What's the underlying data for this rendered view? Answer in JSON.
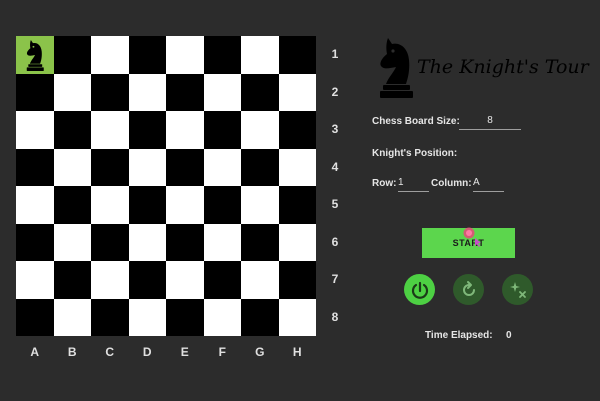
{
  "title": "The Knight's Tour",
  "board": {
    "size": 8,
    "knight_square": "A1",
    "rows": [
      "1",
      "2",
      "3",
      "4",
      "5",
      "6",
      "7",
      "8"
    ],
    "columns": [
      "A",
      "B",
      "C",
      "D",
      "E",
      "F",
      "G",
      "H"
    ],
    "colors": {
      "light": "#ffffff",
      "dark": "#000000",
      "knight_highlight": "#8bc34a"
    }
  },
  "form": {
    "board_size_label": "Chess Board Size:",
    "board_size_value": "8",
    "position_label": "Knight's Position:",
    "row_label": "Row:",
    "row_value": "1",
    "column_label": "Column:",
    "column_value": "A"
  },
  "controls": {
    "start_label": "START",
    "start_color": "#5cd64d",
    "icons": [
      "power-dial-icon",
      "restart-icon",
      "clear-sparkle-icon"
    ]
  },
  "status": {
    "time_label": "Time Elapsed:",
    "time_value": "0"
  }
}
